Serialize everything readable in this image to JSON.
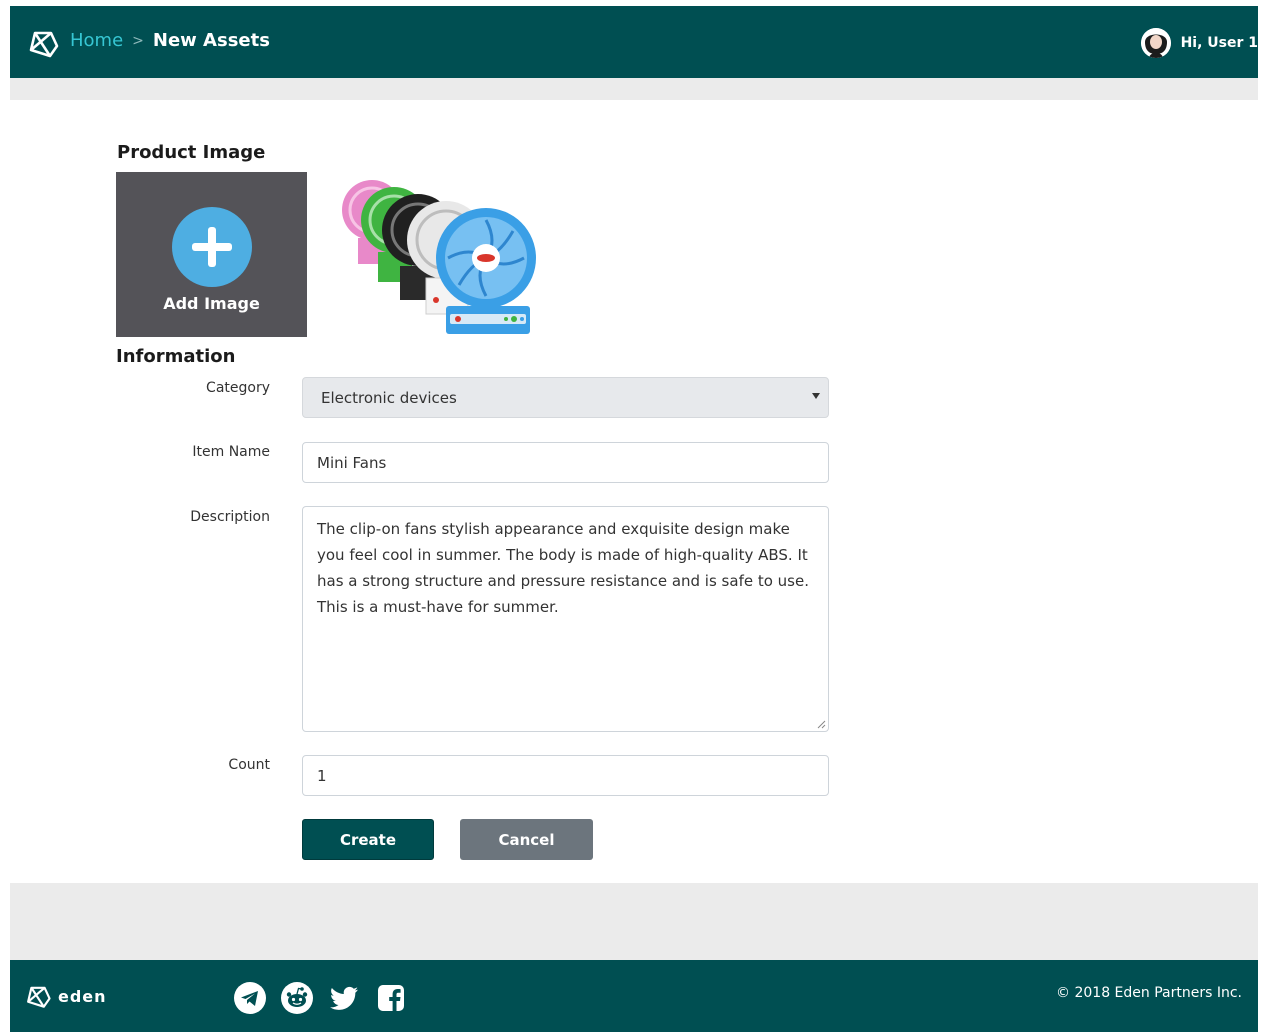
{
  "header": {
    "breadcrumb": {
      "home": "Home",
      "separator": ">",
      "current": "New Assets"
    },
    "user_greeting": "Hi, User 1"
  },
  "product_image": {
    "title": "Product Image",
    "add_label": "Add Image",
    "add_icon": "plus-icon",
    "photo_icon": "mini-fan-photo"
  },
  "information": {
    "title": "Information",
    "category": {
      "label": "Category",
      "value": "Electronic devices"
    },
    "item_name": {
      "label": "Item Name",
      "value": "Mini Fans"
    },
    "description": {
      "label": "Description",
      "value": "The clip-on fans stylish appearance and exquisite design make you feel cool in summer. The body is made of high-quality ABS. It has a strong structure and pressure resistance and is safe to use. This is a must-have for summer."
    },
    "count": {
      "label": "Count",
      "value": "1"
    }
  },
  "actions": {
    "create": "Create",
    "cancel": "Cancel"
  },
  "footer": {
    "brand": "eden",
    "socials": [
      "telegram-icon",
      "reddit-icon",
      "twitter-icon",
      "facebook-icon"
    ],
    "copyright": "© 2018 Eden Partners Inc."
  },
  "colors": {
    "primary": "#004f52",
    "accent": "#36c6d3",
    "add_circle": "#4eaee2",
    "add_tile": "#545358",
    "cancel": "#6c757d",
    "band": "#ebebeb"
  }
}
